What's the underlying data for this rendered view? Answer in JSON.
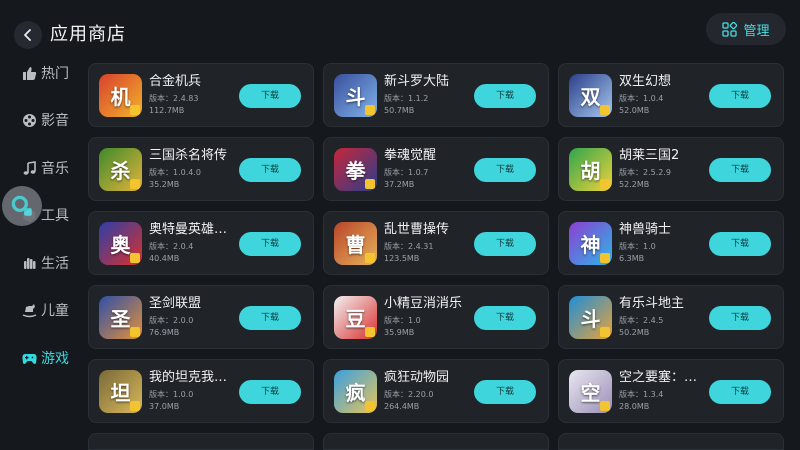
{
  "header": {
    "title": "应用商店",
    "manage_label": "管理"
  },
  "sidebar": {
    "items": [
      {
        "label": "热门",
        "icon": "thumbs-up-icon",
        "active": false
      },
      {
        "label": "影音",
        "icon": "film-reel-icon",
        "active": false
      },
      {
        "label": "音乐",
        "icon": "music-note-icon",
        "active": false
      },
      {
        "label": "工具",
        "icon": "toolbox-icon",
        "active": false
      },
      {
        "label": "生活",
        "icon": "life-hand-icon",
        "active": false
      },
      {
        "label": "儿童",
        "icon": "rocking-horse-icon",
        "active": false
      },
      {
        "label": "游戏",
        "icon": "gamepad-icon",
        "active": true
      }
    ]
  },
  "colors": {
    "accent": "#3ed6dc",
    "background": "#15181c",
    "card": "#202429"
  },
  "apps": [
    {
      "name": "合金机兵",
      "version": "版本：2.4.83",
      "size": "112.7MB",
      "button": "下载",
      "icon_colors": [
        "#d8412f",
        "#f2b32b"
      ],
      "icon_glyph": "机"
    },
    {
      "name": "新斗罗大陆",
      "version": "版本：1.1.2",
      "size": "50.7MB",
      "button": "下载",
      "icon_colors": [
        "#3a4f9e",
        "#7fb3e8"
      ],
      "icon_glyph": "斗"
    },
    {
      "name": "双生幻想",
      "version": "版本：1.0.4",
      "size": "52.0MB",
      "button": "下载",
      "icon_colors": [
        "#2b3f8a",
        "#a6c8f0"
      ],
      "icon_glyph": "双"
    },
    {
      "name": "三国杀名将传",
      "version": "版本：1.0.4.0",
      "size": "35.2MB",
      "button": "下载",
      "icon_colors": [
        "#3f8a2c",
        "#e3b43a"
      ],
      "icon_glyph": "杀"
    },
    {
      "name": "拳魂觉醒",
      "version": "版本：1.0.7",
      "size": "37.2MB",
      "button": "下载",
      "icon_colors": [
        "#c8263a",
        "#2a3e8c"
      ],
      "icon_glyph": "拳"
    },
    {
      "name": "胡莱三国2",
      "version": "版本：2.5.2.9",
      "size": "52.2MB",
      "button": "下载",
      "icon_colors": [
        "#2fa54e",
        "#f0d33a"
      ],
      "icon_glyph": "胡"
    },
    {
      "name": "奥特曼英雄…",
      "version": "版本：2.0.4",
      "size": "40.4MB",
      "button": "下载",
      "icon_colors": [
        "#2d3fa8",
        "#d9312b"
      ],
      "icon_glyph": "奥"
    },
    {
      "name": "乱世曹操传",
      "version": "版本：2.4.31",
      "size": "123.5MB",
      "button": "下载",
      "icon_colors": [
        "#b8452a",
        "#e8b35a"
      ],
      "icon_glyph": "曹"
    },
    {
      "name": "神兽骑士",
      "version": "版本：1.0",
      "size": "6.3MB",
      "button": "下载",
      "icon_colors": [
        "#8a3fd1",
        "#2fb6e8"
      ],
      "icon_glyph": "神"
    },
    {
      "name": "圣剑联盟",
      "version": "版本：2.0.0",
      "size": "76.9MB",
      "button": "下载",
      "icon_colors": [
        "#2f4fa8",
        "#e3913a"
      ],
      "icon_glyph": "圣"
    },
    {
      "name": "小精豆消消乐",
      "version": "版本：1.0",
      "size": "35.9MB",
      "button": "下载",
      "icon_colors": [
        "#f2f2f2",
        "#d8302f"
      ],
      "icon_glyph": "豆"
    },
    {
      "name": "有乐斗地主",
      "version": "版本：2.4.5",
      "size": "50.2MB",
      "button": "下载",
      "icon_colors": [
        "#1f8fd8",
        "#e8a23a"
      ],
      "icon_glyph": "斗"
    },
    {
      "name": "我的坦克我…",
      "version": "版本：1.0.0",
      "size": "37.0MB",
      "button": "下载",
      "icon_colors": [
        "#7a6a3a",
        "#d8b85a"
      ],
      "icon_glyph": "坦"
    },
    {
      "name": "疯狂动物园",
      "version": "版本：2.20.0",
      "size": "264.4MB",
      "button": "下载",
      "icon_colors": [
        "#3aa0e0",
        "#e8c45a"
      ],
      "icon_glyph": "疯"
    },
    {
      "name": "空之要塞：…",
      "version": "版本：1.3.4",
      "size": "28.0MB",
      "button": "下载",
      "icon_colors": [
        "#e9e6ef",
        "#9a8fb8"
      ],
      "icon_glyph": "空"
    }
  ]
}
